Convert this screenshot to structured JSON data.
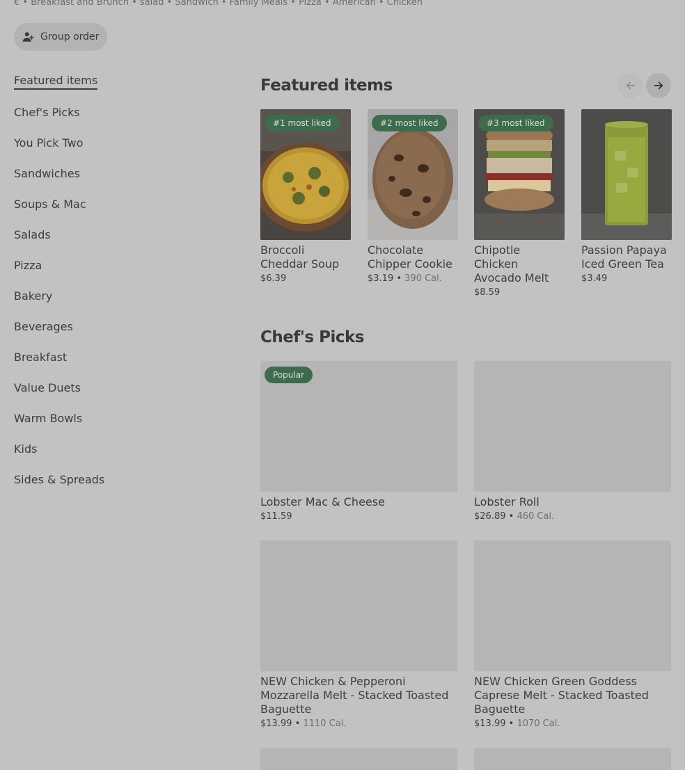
{
  "store": {
    "tags_line": "€ • Breakfast and Brunch • salad • Sandwich • Family Meals • Pizza • American • Chicken",
    "group_order_label": "Group order"
  },
  "sidebar": {
    "items": [
      {
        "label": "Featured items"
      },
      {
        "label": "Chef's Picks"
      },
      {
        "label": "You Pick Two"
      },
      {
        "label": "Sandwiches"
      },
      {
        "label": "Soups & Mac"
      },
      {
        "label": "Salads"
      },
      {
        "label": "Pizza"
      },
      {
        "label": "Bakery"
      },
      {
        "label": "Beverages"
      },
      {
        "label": "Breakfast"
      },
      {
        "label": "Value Duets"
      },
      {
        "label": "Warm Bowls"
      },
      {
        "label": "Kids"
      },
      {
        "label": "Sides & Spreads"
      }
    ]
  },
  "featured": {
    "title": "Featured items",
    "items": [
      {
        "badge": "#1 most liked",
        "name": "Broccoli Cheddar Soup",
        "price": "$6.39",
        "calories": ""
      },
      {
        "badge": "#2 most liked",
        "name": "Chocolate Chipper Cookie",
        "price": "$3.19",
        "calories": "390 Cal."
      },
      {
        "badge": "#3 most liked",
        "name": "Chipotle Chicken Avocado Melt",
        "price": "$8.59",
        "calories": ""
      },
      {
        "badge": "",
        "name": "Passion Papaya Iced Green Tea",
        "price": "$3.49",
        "calories": ""
      }
    ]
  },
  "chefs_picks": {
    "title": "Chef's Picks",
    "items": [
      {
        "badge": "Popular",
        "name": "Lobster Mac & Cheese",
        "price": "$11.59",
        "calories": ""
      },
      {
        "badge": "",
        "name": "Lobster Roll",
        "price": "$26.89",
        "calories": "460 Cal."
      },
      {
        "badge": "",
        "name": "NEW Chicken & Pepperoni Mozzarella Melt - Stacked Toasted Baguette",
        "price": "$13.99",
        "calories": "1110 Cal."
      },
      {
        "badge": "",
        "name": "NEW Chicken Green Goddess Caprese Melt - Stacked Toasted Baguette",
        "price": "$13.99",
        "calories": "1070 Cal."
      }
    ]
  },
  "icons": {
    "group_order": "person-add-icon",
    "prev": "arrow-left-icon",
    "next": "arrow-right-icon"
  },
  "colors": {
    "badge_bg": "#3f6b4d",
    "page_bg": "#c2c2c2"
  }
}
